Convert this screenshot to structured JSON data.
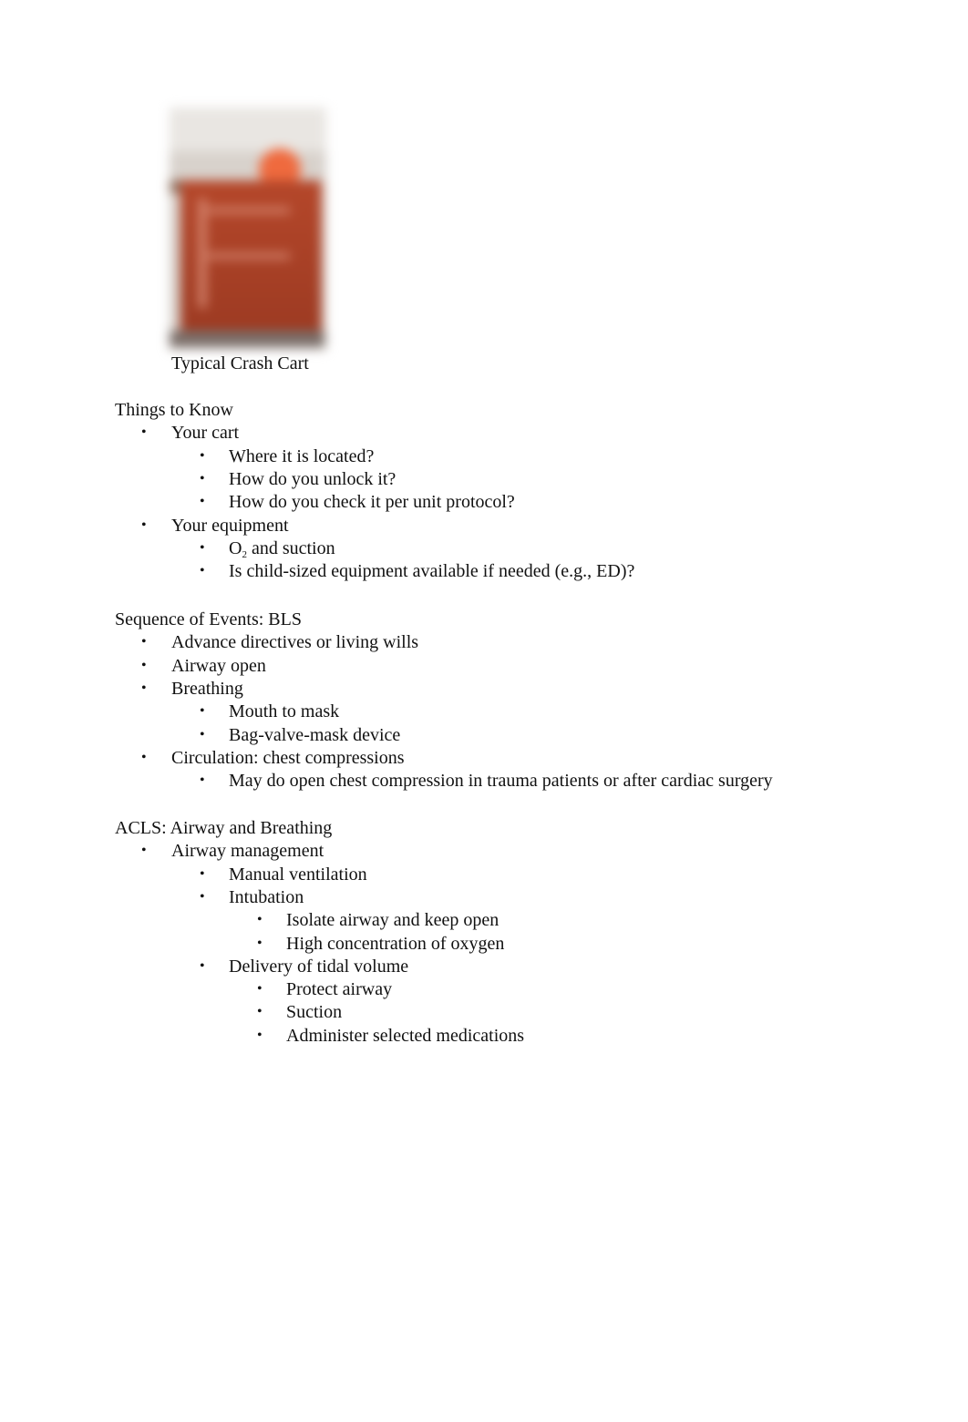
{
  "figure": {
    "image_alt": "crash-cart-photo",
    "caption": "Typical Crash Cart"
  },
  "sections": [
    {
      "heading": "Things to Know",
      "items": [
        {
          "level": 1,
          "text": "Your cart"
        },
        {
          "level": 2,
          "text": "Where it is located?"
        },
        {
          "level": 2,
          "text": "How do you unlock it?"
        },
        {
          "level": 2,
          "text": "How do you check it per unit protocol?"
        },
        {
          "level": 1,
          "text": "Your equipment"
        },
        {
          "level": 2,
          "text": "O",
          "sub": "2",
          "after": " and suction"
        },
        {
          "level": 2,
          "text": "Is child-sized equipment available if needed (e.g., ED)?"
        }
      ]
    },
    {
      "heading": "Sequence of Events: BLS",
      "items": [
        {
          "level": 1,
          "text": "Advance directives or living wills"
        },
        {
          "level": 1,
          "text": "Airway open"
        },
        {
          "level": 1,
          "text": "Breathing"
        },
        {
          "level": 2,
          "text": "Mouth to mask"
        },
        {
          "level": 2,
          "text": "Bag-valve-mask device"
        },
        {
          "level": 1,
          "text": "Circulation: chest compressions"
        },
        {
          "level": 2,
          "text": "May do open chest compression in trauma patients or after cardiac surgery"
        }
      ]
    },
    {
      "heading": "ACLS: Airway and Breathing",
      "items": [
        {
          "level": 1,
          "text": "Airway management"
        },
        {
          "level": 2,
          "text": "Manual ventilation"
        },
        {
          "level": 2,
          "text": "Intubation"
        },
        {
          "level": 3,
          "text": "Isolate airway and keep open"
        },
        {
          "level": 3,
          "text": "High concentration of oxygen"
        },
        {
          "level": 2,
          "text": "Delivery of tidal volume"
        },
        {
          "level": 3,
          "text": "Protect airway"
        },
        {
          "level": 3,
          "text": "Suction"
        },
        {
          "level": 3,
          "text": "Administer selected medications"
        }
      ]
    }
  ],
  "bullet_glyph": "•"
}
